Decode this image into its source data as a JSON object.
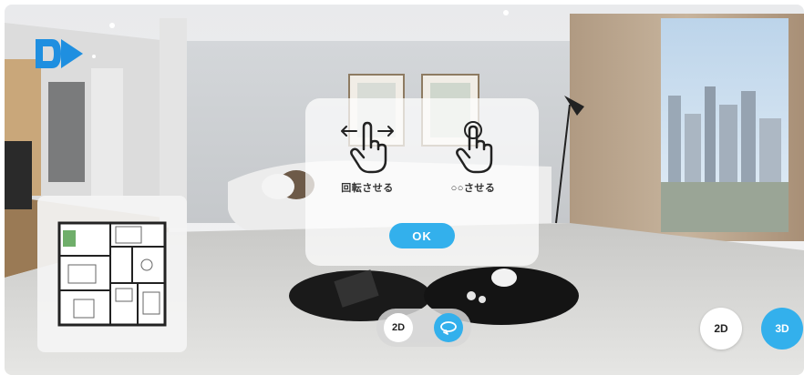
{
  "guide": {
    "rotate_label": "回転させる",
    "zoom_label": "○○させる",
    "ok_label": "OK"
  },
  "mode_toggle": {
    "label_2d": "2D",
    "rotate_icon": "rotate-icon"
  },
  "view_switch": {
    "label_2d": "2D",
    "label_3d": "3D"
  },
  "icons": {
    "logo": "dp-logo",
    "swipe": "swipe-hand-icon",
    "tap": "tap-hand-icon",
    "floorplan": "floorplan-thumbnail"
  },
  "colors": {
    "accent": "#33b0ec",
    "logo_blue": "#1f8fe0"
  }
}
